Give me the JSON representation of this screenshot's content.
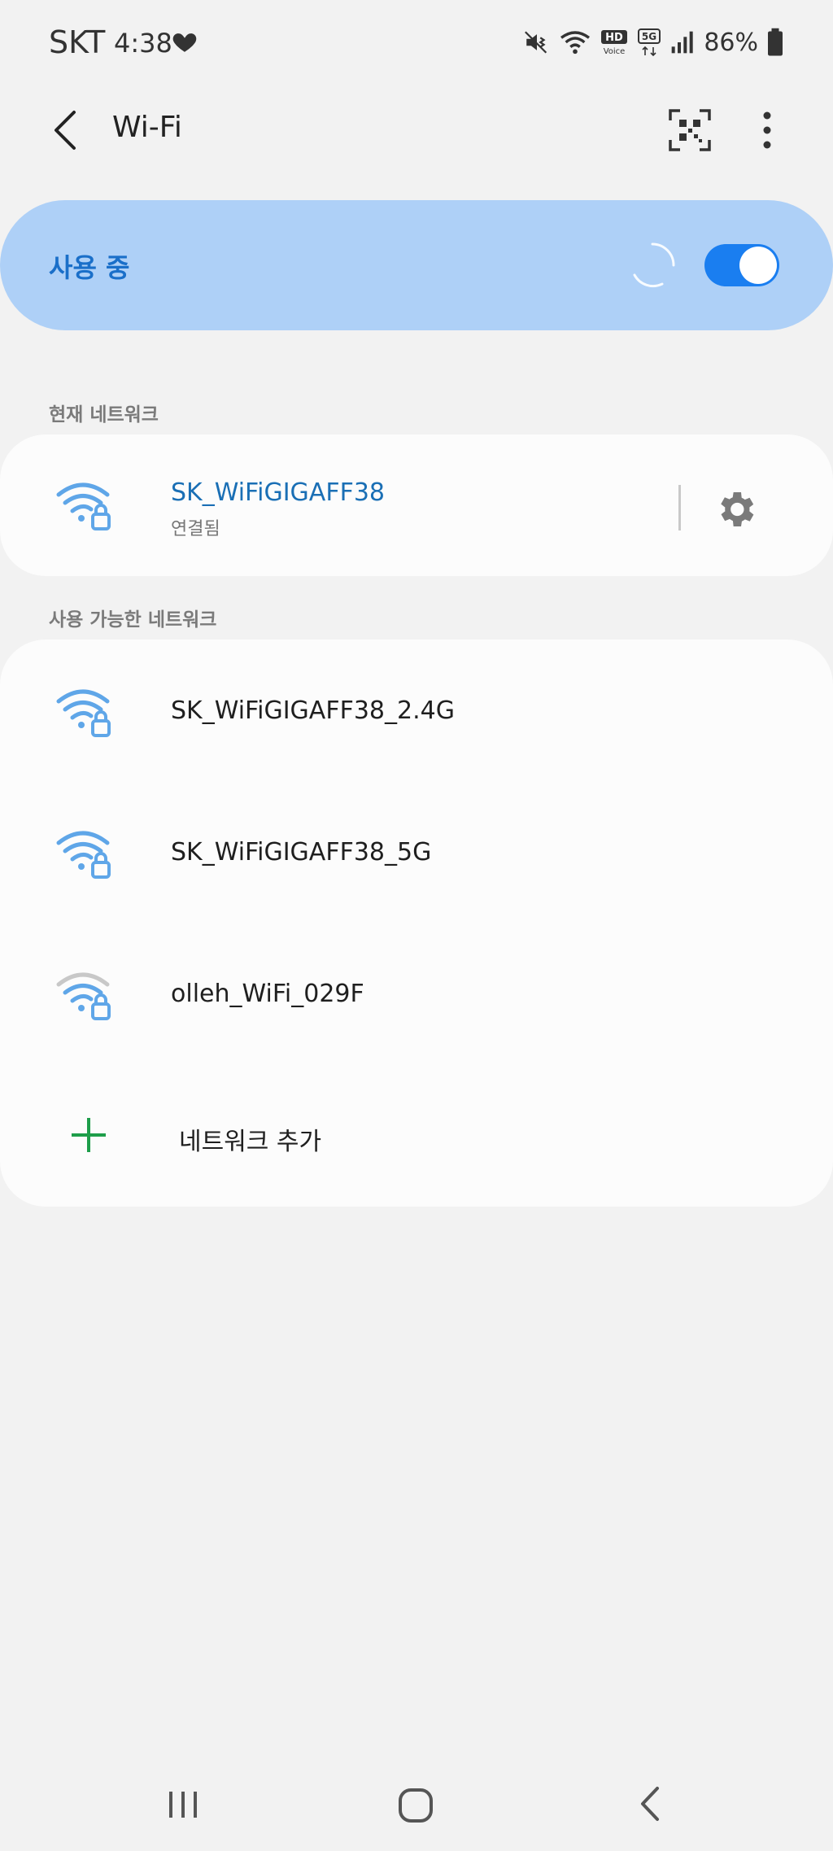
{
  "status_bar": {
    "carrier": "SKT",
    "time": "4:38",
    "battery": "86%",
    "icons": [
      "heart-icon",
      "mute-icon",
      "wifi-signal-icon",
      "hd-voice-icon",
      "5g-icon",
      "cell-signal-icon",
      "battery-icon"
    ]
  },
  "header": {
    "title": "Wi-Fi",
    "icons": [
      "back-icon",
      "qr-code-icon",
      "more-options-icon"
    ]
  },
  "master_switch": {
    "label": "사용 중",
    "enabled": true
  },
  "current_network": {
    "section_title": "현재 네트워크",
    "name": "SK_WiFiGIGAFF38",
    "status": "연결됨"
  },
  "available_networks": {
    "section_title": "사용 가능한 네트워크",
    "items": [
      {
        "name": "SK_WiFiGIGAFF38_2.4G",
        "locked": true
      },
      {
        "name": "SK_WiFiGIGAFF38_5G",
        "locked": true
      },
      {
        "name": "olleh_WiFi_029F",
        "locked": true
      }
    ],
    "add_network_label": "네트워크 추가"
  },
  "colors": {
    "accent": "#1a7ef0",
    "master_card": "#aed0f7",
    "wifi_strong": "#5fa6e8",
    "wifi_weak": "#c8c8c8",
    "add_green": "#1e9e4a"
  },
  "nav_bar": {
    "icons": [
      "recents-icon",
      "home-icon",
      "back-nav-icon"
    ]
  }
}
